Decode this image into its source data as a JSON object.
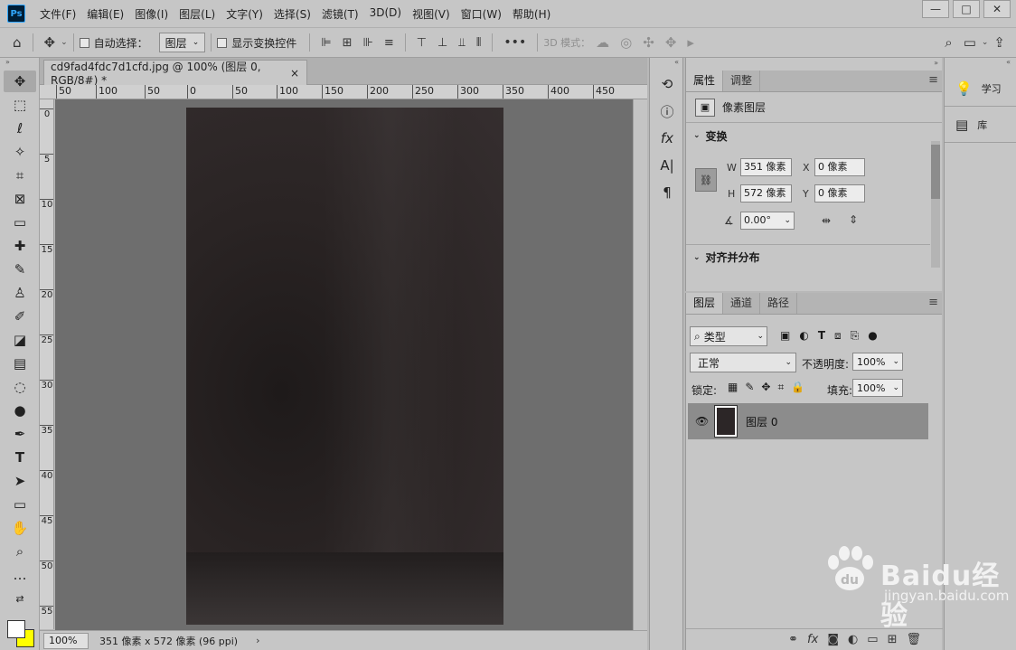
{
  "app": {
    "logo": "Ps"
  },
  "menu": [
    "文件(F)",
    "编辑(E)",
    "图像(I)",
    "图层(L)",
    "文字(Y)",
    "选择(S)",
    "滤镜(T)",
    "3D(D)",
    "视图(V)",
    "窗口(W)",
    "帮助(H)"
  ],
  "window_controls": [
    "—",
    "□",
    "✕"
  ],
  "options": {
    "auto_select_label": "自动选择：",
    "auto_select_value": "图层",
    "show_transform_label": "显示变换控件",
    "mode_3d_label": "3D 模式："
  },
  "document": {
    "tab_title": "cd9fad4fdc7d1cfd.jpg @ 100% (图层 0, RGB/8#) *",
    "close": "×"
  },
  "ruler_h": [
    "50",
    "100",
    "50",
    "0",
    "50",
    "100",
    "150",
    "200",
    "250",
    "300",
    "350",
    "400",
    "450"
  ],
  "ruler_v": [
    "0",
    "5",
    "10",
    "15",
    "20",
    "25",
    "30",
    "35",
    "40",
    "45",
    "50",
    "55"
  ],
  "status": {
    "zoom": "100%",
    "info": "351 像素 x 572 像素 (96 ppi)",
    "arrow": "›"
  },
  "properties": {
    "tabs": [
      "属性",
      "调整"
    ],
    "layer_type": "像素图层",
    "transform_title": "变换",
    "w_label": "W",
    "w_value": "351 像素",
    "h_label": "H",
    "h_value": "572 像素",
    "x_label": "X",
    "x_value": "0 像素",
    "y_label": "Y",
    "y_value": "0 像素",
    "angle_value": "0.00°",
    "align_title": "对齐并分布"
  },
  "layers": {
    "tabs": [
      "图层",
      "通道",
      "路径"
    ],
    "filter_kind": "类型",
    "blend_mode": "正常",
    "opacity_label": "不透明度:",
    "opacity_value": "100%",
    "lock_label": "锁定:",
    "fill_label": "填充:",
    "fill_value": "100%",
    "items": [
      {
        "name": "图层 0"
      }
    ]
  },
  "right_panel": {
    "learn": "学习",
    "library": "库"
  },
  "watermark": {
    "brand": "Baidu经验",
    "url": "jingyan.baidu.com"
  }
}
